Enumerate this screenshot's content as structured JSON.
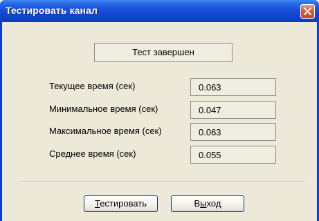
{
  "window": {
    "title": "Тестировать канал"
  },
  "icons": {
    "close": "close-icon"
  },
  "status": {
    "text": "Тест завершен"
  },
  "stats": [
    {
      "label": "Текущее время (сек)",
      "value": "0.063"
    },
    {
      "label": "Минимальное время (сек)",
      "value": "0.047"
    },
    {
      "label": "Максимальное время (сек)",
      "value": "0.063"
    },
    {
      "label": "Среднее время (сек)",
      "value": "0.055"
    }
  ],
  "buttons": {
    "test_prefix": "",
    "test_mnemonic": "Т",
    "test_rest": "естировать",
    "exit_prefix": "В",
    "exit_mnemonic": "ы",
    "exit_rest": "ход"
  },
  "colors": {
    "titlebar": "#1d56de",
    "dialog_bg": "#ece9d8",
    "close_button": "#d9613c"
  }
}
